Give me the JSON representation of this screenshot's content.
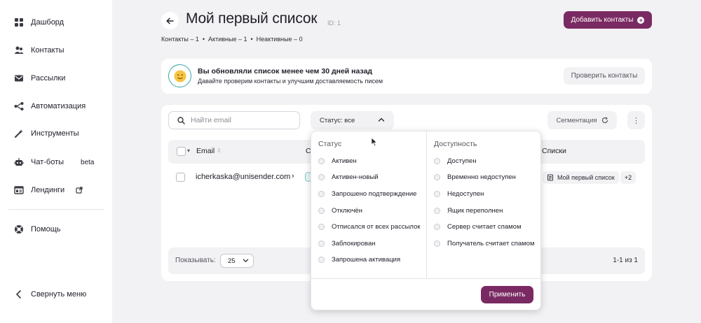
{
  "sidebar": {
    "items": [
      {
        "label": "Дашборд",
        "icon": "dashboard-icon"
      },
      {
        "label": "Контакты",
        "icon": "contacts-icon"
      },
      {
        "label": "Рассылки",
        "icon": "mail-icon"
      },
      {
        "label": "Автоматизация",
        "icon": "automation-icon"
      },
      {
        "label": "Инструменты",
        "icon": "tools-icon"
      },
      {
        "label": "Чат-боты",
        "icon": "bot-icon",
        "badge": "beta"
      },
      {
        "label": "Лендинги",
        "icon": "landing-icon"
      }
    ],
    "help": "Помощь",
    "collapse": "Свернуть меню"
  },
  "header": {
    "title": "Мой первый список",
    "id_label": "ID: 1",
    "counts": {
      "contacts": "Контакты – 1",
      "active": "Активные – 1",
      "inactive": "Неактивные – 0"
    },
    "add_button": "Добавить контакты"
  },
  "banner": {
    "title": "Вы обновляли список менее чем 30 дней назад",
    "subtitle": "Давайте проверим контакты и улучшим доставляемость писем",
    "button": "Проверить контакты"
  },
  "toolbar": {
    "search_placeholder": "Найти email",
    "status_filter": "Статус: все",
    "segmentation": "Сегментация"
  },
  "table": {
    "headers": {
      "email": "Email",
      "status": "С",
      "lists": "Списки"
    },
    "rows": [
      {
        "email": "icherkaska@unisender.com",
        "list": "Мой первый список",
        "more": "+2"
      }
    ]
  },
  "pager": {
    "label": "Показывать:",
    "page_size": "25",
    "range": "1-1 из 1"
  },
  "dropdown": {
    "status_title": "Статус",
    "status_options": [
      "Активен",
      "Активен-новый",
      "Запрошено подтверждение",
      "Отключён",
      "Отписался от всех рассылок",
      "Заблокирован",
      "Запрошена активация"
    ],
    "availability_title": "Доступность",
    "availability_options": [
      "Доступен",
      "Временно недоступен",
      "Недоступен",
      "Ящик переполнен",
      "Сервер считает спамом",
      "Получатель считает спамом"
    ],
    "apply": "Применить"
  },
  "colors": {
    "accent": "#7a2a62",
    "background": "#f2f2f4",
    "teal": "#3aa7a0"
  }
}
